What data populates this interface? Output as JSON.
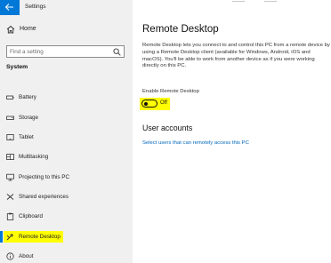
{
  "app": {
    "title": "Settings"
  },
  "sidebar": {
    "home_label": "Home",
    "search_placeholder": "Find a setting",
    "section_title": "System",
    "items": [
      {
        "label": "Battery",
        "icon": "battery-icon"
      },
      {
        "label": "Storage",
        "icon": "storage-icon"
      },
      {
        "label": "Tablet",
        "icon": "tablet-icon"
      },
      {
        "label": "Multitasking",
        "icon": "multitasking-icon"
      },
      {
        "label": "Projecting to this PC",
        "icon": "projecting-icon"
      },
      {
        "label": "Shared experiences",
        "icon": "shared-experiences-icon"
      },
      {
        "label": "Clipboard",
        "icon": "clipboard-icon"
      },
      {
        "label": "Remote Desktop",
        "icon": "remote-desktop-icon",
        "selected": true
      },
      {
        "label": "About",
        "icon": "info-icon"
      }
    ]
  },
  "main": {
    "title": "Remote Desktop",
    "description": "Remote Desktop lets you connect to and control this PC from a remote device by using a Remote Desktop client (available for Windows, Android, iOS and macOS). You'll be able to work from another device as if you were working directly on this PC.",
    "toggle_label": "Enable Remote Desktop",
    "toggle_state": "Off",
    "user_accounts_title": "User accounts",
    "user_accounts_link": "Select users that can remotely access this PC"
  },
  "colors": {
    "accent": "#0078d7",
    "highlight": "#ffff00",
    "link": "#0067b8",
    "sidebar_bg": "#f0f0f0"
  }
}
